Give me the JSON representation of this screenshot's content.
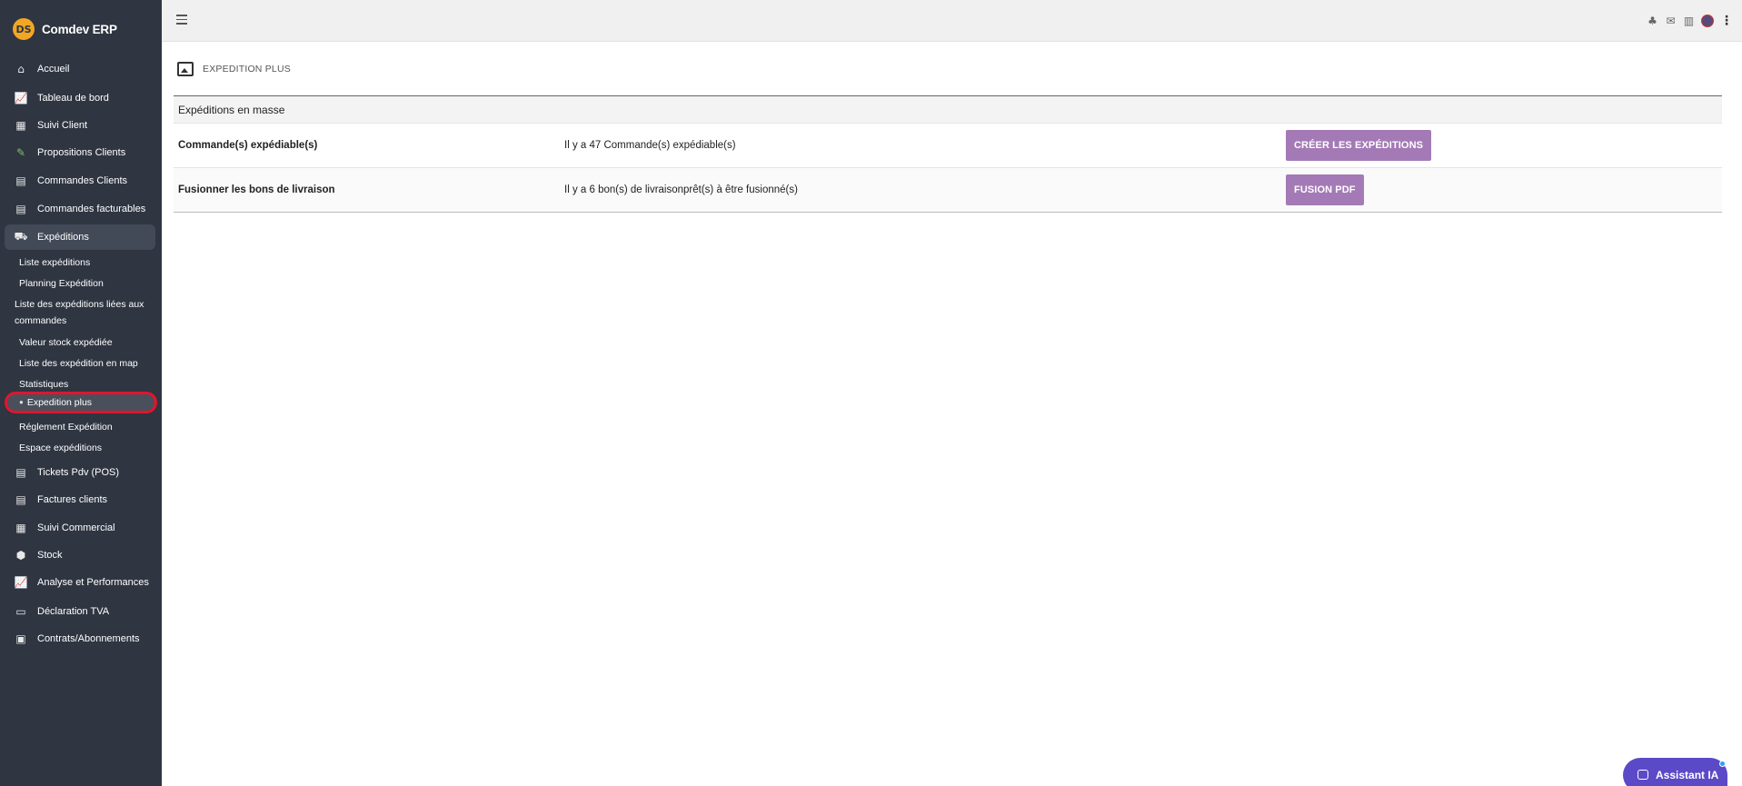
{
  "app": {
    "name": "Comdev ERP",
    "logo_text": "DS"
  },
  "sidebar": {
    "items": [
      {
        "label": "Accueil",
        "icon": "home-icon"
      },
      {
        "label": "Tableau de bord",
        "icon": "chart-line-icon"
      },
      {
        "label": "Suivi Client",
        "icon": "building-icon"
      },
      {
        "label": "Propositions Clients",
        "icon": "file-edit-icon"
      },
      {
        "label": "Commandes Clients",
        "icon": "file-icon"
      },
      {
        "label": "Commandes facturables",
        "icon": "file-icon"
      },
      {
        "label": "Expéditions",
        "icon": "dolly-icon"
      },
      {
        "label": "Tickets Pdv (POS)",
        "icon": "file-icon"
      },
      {
        "label": "Factures clients",
        "icon": "file-icon"
      },
      {
        "label": "Suivi Commercial",
        "icon": "building-icon"
      },
      {
        "label": "Stock",
        "icon": "box-icon"
      },
      {
        "label": "Analyse et Performances",
        "icon": "chart-line-icon"
      },
      {
        "label": "Déclaration TVA",
        "icon": "money-icon"
      },
      {
        "label": "Contrats/Abonnements",
        "icon": "briefcase-icon"
      }
    ],
    "expeditions_sub": [
      "Liste expéditions",
      "Planning Expédition",
      "Liste des expéditions liées aux commandes",
      "Valeur stock expédiée",
      "Liste des expédition en map",
      "Statistiques",
      "Expedition plus",
      "Réglement Expédition",
      "Espace expéditions"
    ]
  },
  "page": {
    "title": "EXPEDITION PLUS",
    "table_header": "Expéditions en masse",
    "rows": [
      {
        "label": "Commande(s) expédiable(s)",
        "info": "Il y a 47 Commande(s) expédiable(s)",
        "button": "CRÉER LES EXPÉDITIONS"
      },
      {
        "label": "Fusionner les bons de livraison",
        "info": "Il y a 6 bon(s) de livraisonprêt(s) à être fusionné(s)",
        "button": "FUSION PDF"
      }
    ]
  },
  "assistant": {
    "label": "Assistant IA"
  },
  "colors": {
    "sidebar_bg": "#2f3541",
    "accent_button": "#a47ab6",
    "assistant": "#5b4ac7",
    "highlight": "#e3142d"
  }
}
